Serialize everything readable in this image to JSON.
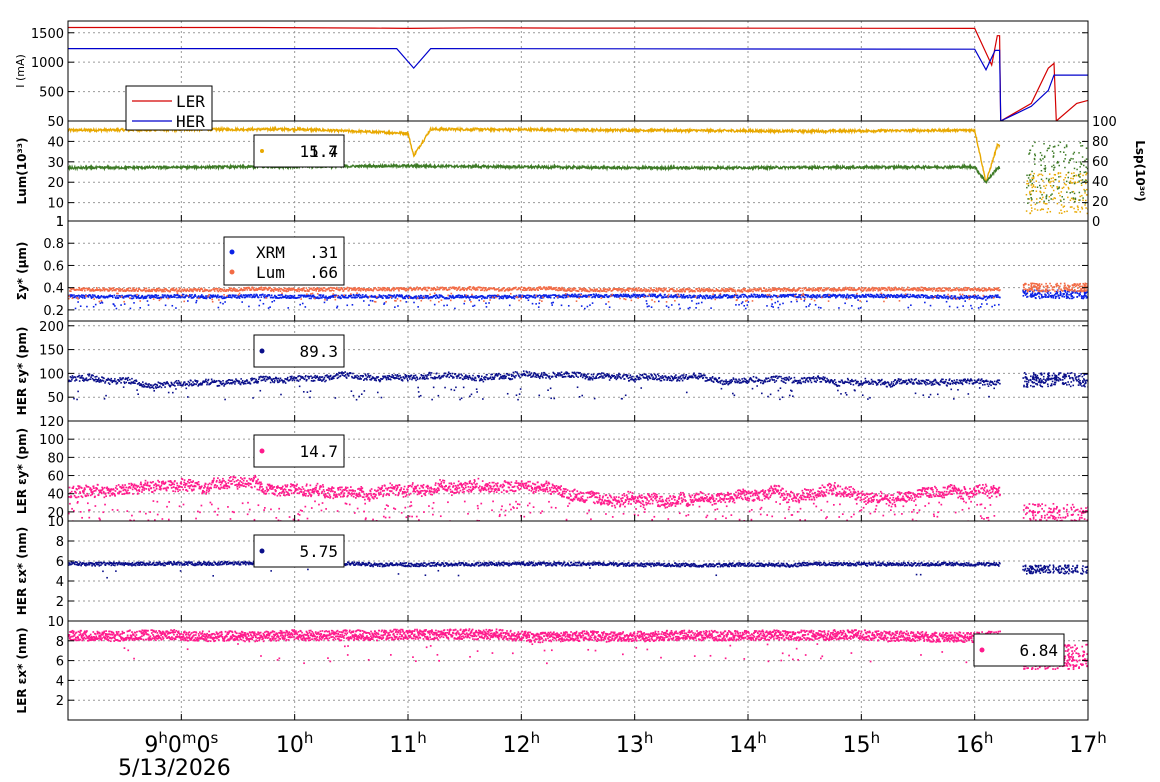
{
  "chart_data": [
    {
      "type": "line",
      "panel": "beam-current",
      "ylabel": "I (mA)",
      "ylim": [
        0,
        1700
      ],
      "yticks": [
        "500",
        "1000",
        "1500"
      ],
      "legend": [
        "LER",
        "HER"
      ],
      "series": [
        {
          "name": "LER",
          "color": "#d40000",
          "x": [
            8.0,
            9.6,
            10.7,
            11.0,
            11.6,
            12.4,
            13.5,
            16.0,
            16.15,
            16.2,
            16.22,
            16.23,
            16.5,
            16.65,
            16.7,
            16.72,
            16.9,
            17.0
          ],
          "values": [
            1590,
            1590,
            1580,
            1575,
            1585,
            1580,
            1580,
            1575,
            950,
            1450,
            1450,
            0,
            300,
            900,
            980,
            0,
            300,
            350
          ]
        },
        {
          "name": "HER",
          "color": "#0000cc",
          "x": [
            8.0,
            10.9,
            11.05,
            11.2,
            16.0,
            16.1,
            16.18,
            16.22,
            16.23,
            16.5,
            16.65,
            16.7,
            16.9,
            17.0
          ],
          "values": [
            1230,
            1230,
            900,
            1230,
            1220,
            870,
            1200,
            1200,
            0,
            250,
            520,
            780,
            780,
            780
          ]
        }
      ]
    },
    {
      "type": "line",
      "panel": "luminosity",
      "ylabel": "Lum(10³³)",
      "ylabel2": "Lsp(10³⁰)",
      "ylim": [
        1,
        50
      ],
      "ylim2": [
        0,
        100
      ],
      "yticks": [
        "1",
        "10",
        "20",
        "30",
        "40",
        "50"
      ],
      "yticks2": [
        "0",
        "20",
        "40",
        "60",
        "80",
        "100"
      ],
      "legend_value": "15.7",
      "legend_value2": "1.4",
      "series": [
        {
          "color": "#e8a800",
          "x": [
            8.0,
            10.0,
            11.0,
            11.05,
            11.2,
            13.0,
            14.5,
            16.0,
            16.1,
            16.2
          ],
          "values": [
            45.5,
            46,
            44,
            33,
            46,
            45.5,
            45,
            45.5,
            20,
            38
          ]
        },
        {
          "color": "#3d7a26",
          "x": [
            8.0,
            11.0,
            13.0,
            16.0,
            16.1,
            16.2
          ],
          "values": [
            27,
            28,
            27,
            27.5,
            20,
            27
          ]
        }
      ]
    },
    {
      "type": "scatter",
      "panel": "sigma-y",
      "ylabel": "Σy* (μm)",
      "ylim": [
        0.1,
        1.0
      ],
      "yticks": [
        "0.2",
        "0.4",
        "0.6",
        "0.8",
        "1"
      ],
      "legend": [
        "XRM",
        "Lum"
      ],
      "legend_values": [
        ".31",
        ".66"
      ],
      "series": [
        {
          "name": "XRM",
          "color": "#0b22e6",
          "level": 0.33
        },
        {
          "name": "Lum",
          "color": "#f26b45",
          "level": 0.39
        }
      ]
    },
    {
      "type": "scatter",
      "panel": "her-eps-y",
      "ylabel": "HER εy* (pm)",
      "ylim": [
        0,
        210
      ],
      "yticks": [
        "50",
        "100",
        "150",
        "200"
      ],
      "legend_value": "89.3",
      "series": [
        {
          "color": "#0a0f8a",
          "level": 88
        }
      ]
    },
    {
      "type": "scatter",
      "panel": "ler-eps-y",
      "ylabel": "LER εy* (pm)",
      "ylim": [
        10,
        120
      ],
      "yticks": [
        "10",
        "20",
        "40",
        "60",
        "80",
        "100",
        "120"
      ],
      "legend_value": "14.7",
      "series": [
        {
          "color": "#ff1a8c",
          "level": 43
        }
      ]
    },
    {
      "type": "scatter",
      "panel": "her-eps-x",
      "ylabel": "HER εx* (nm)",
      "ylim": [
        0,
        10
      ],
      "yticks": [
        "2",
        "4",
        "6",
        "8"
      ],
      "legend_value": "5.75",
      "series": [
        {
          "color": "#0a0f8a",
          "level": 5.8
        }
      ]
    },
    {
      "type": "scatter",
      "panel": "ler-eps-x",
      "ylabel": "LER εx* (nm)",
      "ylim": [
        0,
        10
      ],
      "yticks": [
        "2",
        "4",
        "6",
        "8",
        "10"
      ],
      "legend_value": "6.84",
      "series": [
        {
          "color": "#ff1a8c",
          "level": 8.6
        }
      ]
    }
  ],
  "x_axis": {
    "range": [
      8.0,
      17.0
    ],
    "tick_labels": [
      {
        "at": 9,
        "label": "9",
        "sup": "h",
        "rest": "0",
        "sup2": "m",
        "rest2": "0",
        "sup3": "s"
      },
      {
        "at": 10,
        "label": "10",
        "sup": "h"
      },
      {
        "at": 11,
        "label": "11",
        "sup": "h"
      },
      {
        "at": 12,
        "label": "12",
        "sup": "h"
      },
      {
        "at": 13,
        "label": "13",
        "sup": "h"
      },
      {
        "at": 14,
        "label": "14",
        "sup": "h"
      },
      {
        "at": 15,
        "label": "15",
        "sup": "h"
      },
      {
        "at": 16,
        "label": "16",
        "sup": "h"
      },
      {
        "at": 17,
        "label": "17",
        "sup": "h"
      }
    ],
    "date": "5/13/2026"
  }
}
